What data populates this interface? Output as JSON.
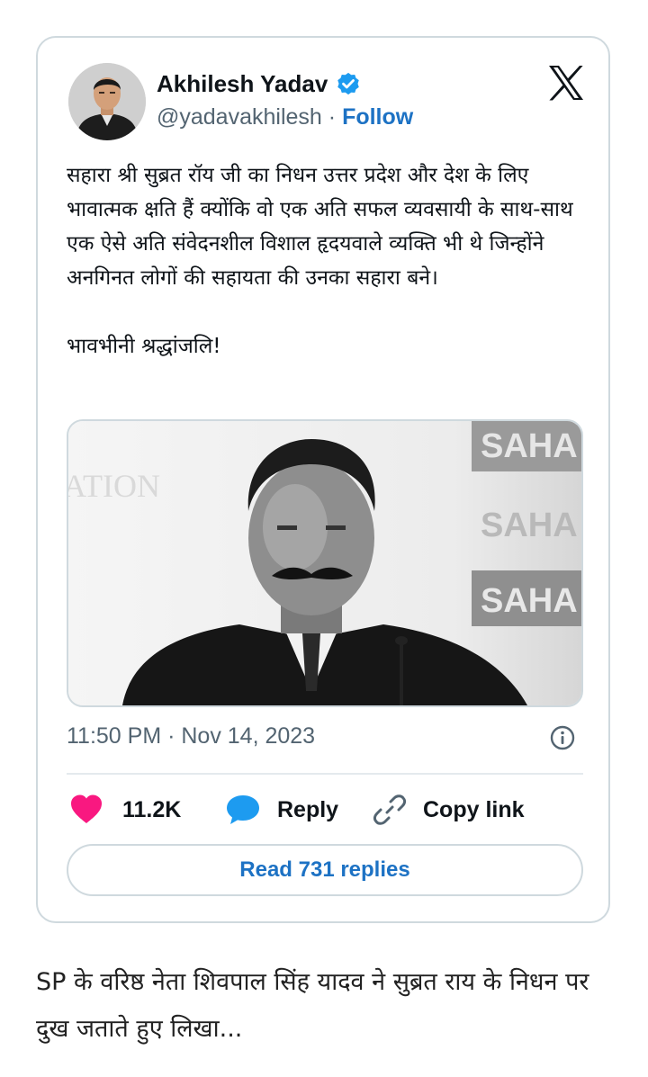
{
  "tweet": {
    "author_name": "Akhilesh Yadav",
    "handle": "@yadavakhilesh",
    "separator": "·",
    "follow_label": "Follow",
    "text": "सहारा श्री सुब्रत रॉय जी का निधन उत्तर प्रदेश और देश के लिए भावात्मक क्षति हैं क्योंकि वो एक अति सफल व्यवसायी के साथ-साथ एक ऐसे अति संवेदनशील विशाल हृदयवाले व्यक्ति भी थे जिन्होंने अनगिनत लोगों की सहायता की उनका सहारा बने।",
    "tribute": "भावभीनी श्रद्धांजलि!",
    "image_backdrop_text": [
      "SAHA",
      "SAHA",
      "SAHA",
      "ATION"
    ],
    "timestamp": "11:50 PM · Nov 14, 2023",
    "likes": "11.2K",
    "reply_label": "Reply",
    "copy_link_label": "Copy link",
    "read_replies_label": "Read 731 replies"
  },
  "icons": {
    "verified": "verified-badge-icon",
    "brand": "x-logo-icon",
    "info": "info-icon",
    "like": "heart-icon",
    "reply": "speech-bubble-icon",
    "copy": "link-icon"
  },
  "colors": {
    "accent": "#1d72c4",
    "like": "#f91880",
    "reply": "#1d9bf0",
    "muted": "#536471",
    "border": "#cfd9de"
  },
  "caption": "SP के वरिष्ठ नेता शिवपाल सिंह यादव ने सुब्रत राय के निधन पर दुख जताते हुए लिखा..."
}
